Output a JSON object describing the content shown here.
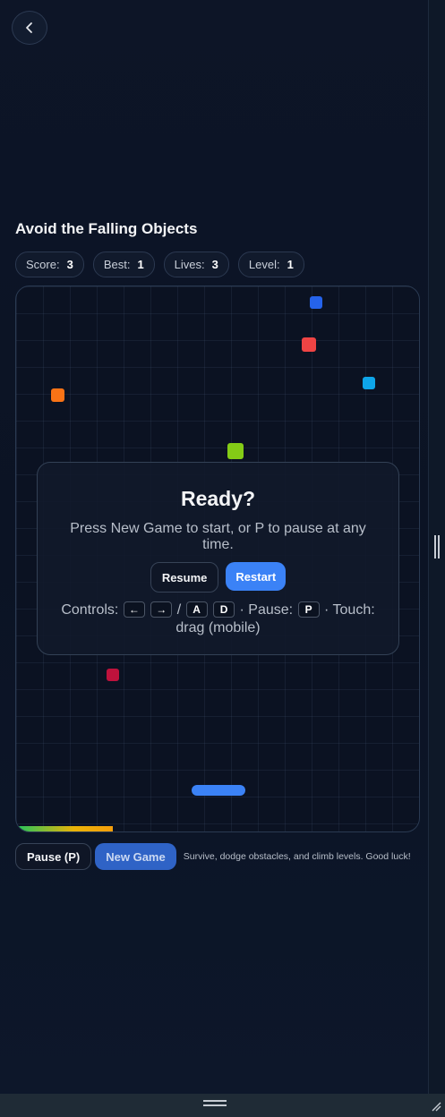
{
  "title": "Avoid the Falling Objects",
  "stats": [
    {
      "label": "Score:",
      "value": "3"
    },
    {
      "label": "Best:",
      "value": "1"
    },
    {
      "label": "Lives:",
      "value": "3"
    },
    {
      "label": "Level:",
      "value": "1"
    }
  ],
  "overlay": {
    "title": "Ready?",
    "text": "Press New Game to start, or P to pause at any time.",
    "resume_label": "Resume",
    "restart_label": "Restart",
    "controls_prefix": "Controls:",
    "keys": {
      "left": "←",
      "right": "→",
      "a": "A",
      "d": "D",
      "p": "P"
    },
    "slash": "/",
    "pause_text": "· Pause:",
    "touch_text": "· Touch: drag (mobile)"
  },
  "progress": 0.24,
  "colors": {
    "accent": "#3b82f6",
    "blue_obj": "#2563eb",
    "red_obj": "#ef4444",
    "sky_obj": "#0ea5e9",
    "orange_obj": "#f97316",
    "green_obj": "#84cc16",
    "crimson_obj": "#be123c"
  },
  "buttons": {
    "pause_label": "Pause (P)",
    "new_game_label": "New Game"
  },
  "hint": "Survive, dodge obstacles, and climb levels. Good luck!",
  "icons": {
    "back": "chevron-left-icon"
  }
}
